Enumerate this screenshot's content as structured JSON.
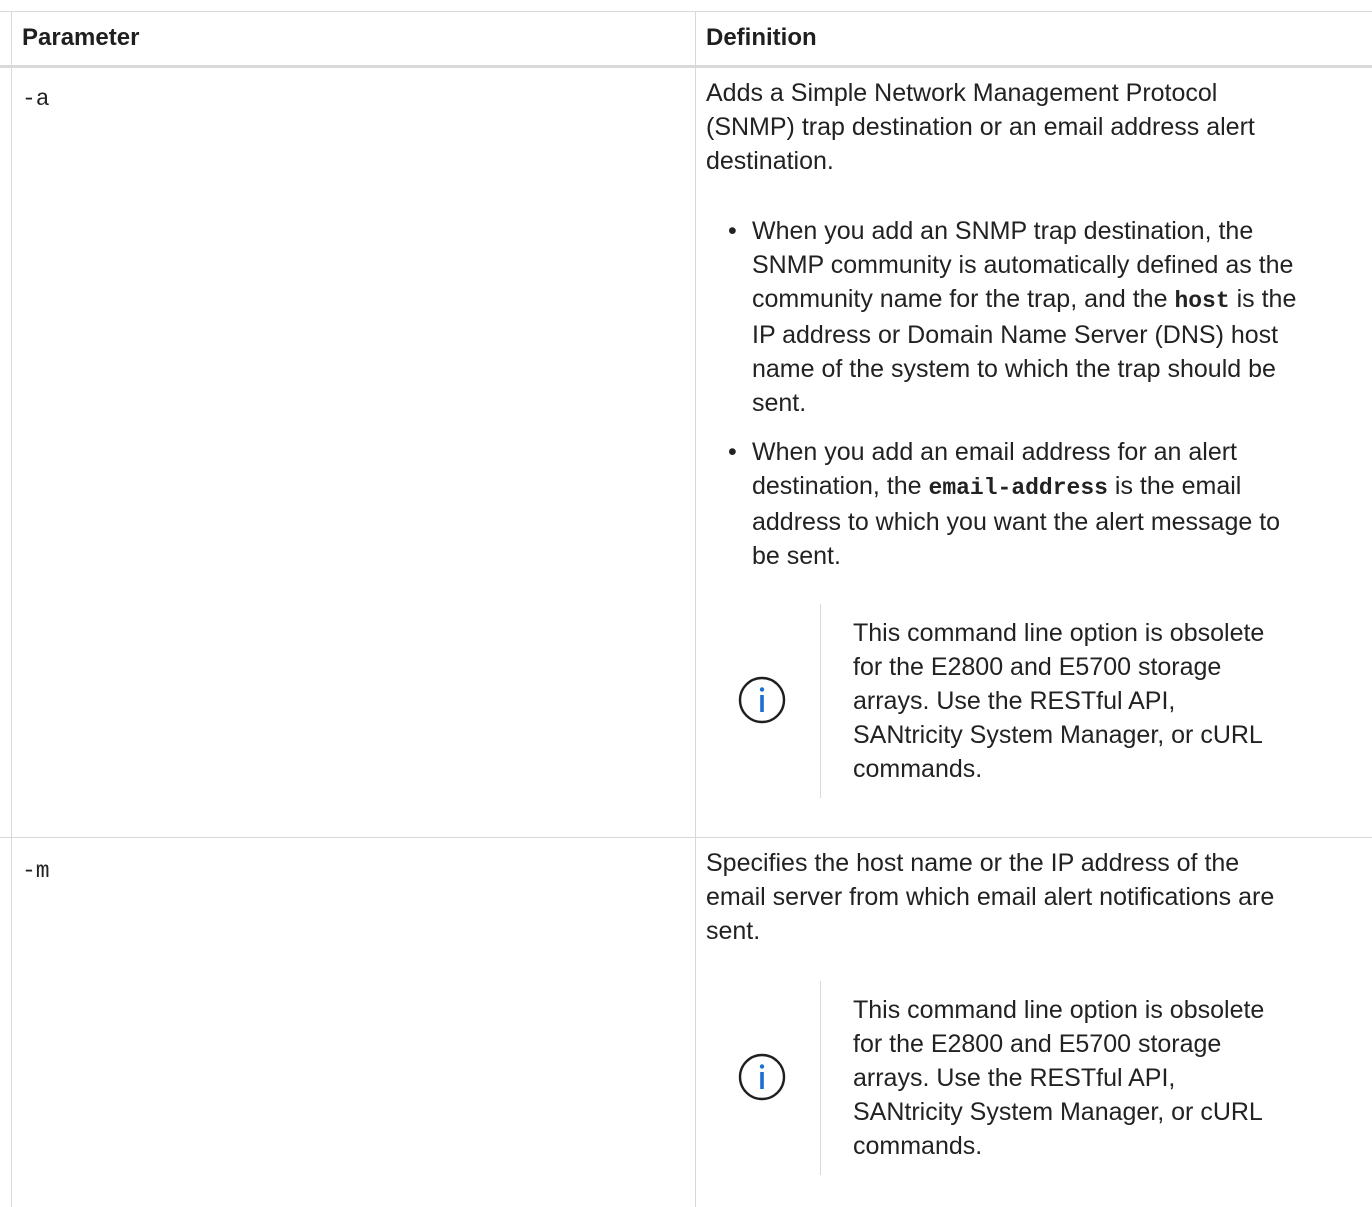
{
  "table": {
    "headers": {
      "parameter": "Parameter",
      "definition": "Definition"
    },
    "rows": [
      {
        "parameter": "-a",
        "definition_lines": [
          "Adds a Simple Network Management Protocol",
          "(SNMP) trap destination or an email address alert",
          "destination."
        ],
        "bullets": [
          {
            "lines": [
              "When you add an SNMP trap destination, the",
              "SNMP community is automatically defined as the",
              {
                "before": "community name for the trap, and the ",
                "code": "host",
                "after": " is the"
              },
              "IP address or Domain Name Server (DNS) host",
              "name of the system to which the trap should be",
              "sent."
            ]
          },
          {
            "lines": [
              "When you add an email address for an alert",
              {
                "before": "destination, the ",
                "code": "email-address",
                "after": " is the email"
              },
              "address to which you want the alert message to",
              "be sent."
            ]
          }
        ],
        "note_lines": [
          "This command line option is obsolete",
          "for the E2800 and E5700 storage",
          "arrays. Use the RESTful API,",
          "SANtricity System Manager, or cURL",
          "commands."
        ],
        "note_icon": "info-icon"
      },
      {
        "parameter": "-m",
        "definition_lines": [
          "Specifies the host name or the IP address of the",
          "email server from which email alert notifications are",
          "sent."
        ],
        "note_lines": [
          "This command line option is obsolete",
          "for the E2800 and E5700 storage",
          "arrays. Use the RESTful API,",
          "SANtricity System Manager, or cURL",
          "commands."
        ],
        "note_icon": "info-icon"
      }
    ],
    "bullet_glyph": "•"
  },
  "colors": {
    "border": "#d9d9d9",
    "text": "#222222",
    "icon": "#1a6fd0"
  }
}
